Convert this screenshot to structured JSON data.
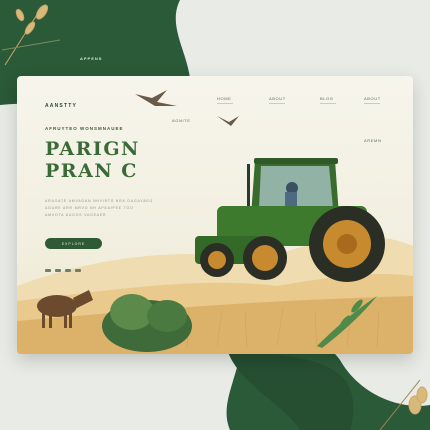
{
  "page": {
    "outer_label": "APPENS",
    "brand": "AANSTTY",
    "menu": [
      "HOME",
      "ABOUT",
      "BLOG",
      "ABOUT"
    ],
    "eyebrow": "AFRUYTEO WONSMNAUEE",
    "headline": "PARIGN\nPRAN C",
    "body_lines": [
      "ARAOATE AMVADAN NHVIRTS NRA OUGAYAEG",
      "AGURE ARR MRVO NH APEAIPEE TOO",
      "AMVOTA AUGOS VAGEAER"
    ],
    "cta": "EXPLORE",
    "side_note": "AGNITE",
    "side_note_2": "AREMN"
  },
  "colors": {
    "accent": "#3a6b36",
    "dark_green": "#2c5a37",
    "wheat": "#e8c98a"
  }
}
